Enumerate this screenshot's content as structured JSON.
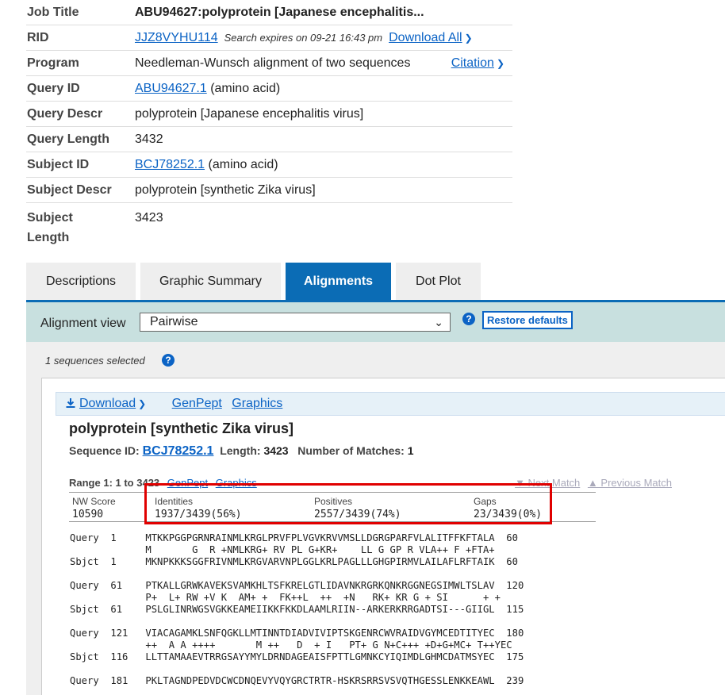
{
  "summary": {
    "job_title": {
      "label": "Job Title",
      "value": "ABU94627:polyprotein [Japanese encephalitis..."
    },
    "rid": {
      "label": "RID",
      "value": "JJZ8VYHU114",
      "expires": "Search expires on 09-21 16:43 pm",
      "download_all": "Download All"
    },
    "program": {
      "label": "Program",
      "value": "Needleman-Wunsch alignment of two sequences",
      "citation": "Citation"
    },
    "query_id": {
      "label": "Query ID",
      "link": "ABU94627.1",
      "suffix": "(amino acid)"
    },
    "query_descr": {
      "label": "Query Descr",
      "value": "polyprotein [Japanese encephalitis virus]"
    },
    "query_length": {
      "label": "Query Length",
      "value": "3432"
    },
    "subject_id": {
      "label": "Subject ID",
      "link": "BCJ78252.1",
      "suffix": "(amino acid)"
    },
    "subject_descr": {
      "label": "Subject Descr",
      "value": "polyprotein [synthetic Zika virus]"
    },
    "subject_length": {
      "label1": "Subject",
      "label2": "Length",
      "value": "3423"
    }
  },
  "tabs": [
    {
      "label": "Descriptions",
      "active": false
    },
    {
      "label": "Graphic Summary",
      "active": false
    },
    {
      "label": "Alignments",
      "active": true
    },
    {
      "label": "Dot Plot",
      "active": false
    }
  ],
  "viewbar": {
    "label": "Alignment view",
    "selected": "Pairwise",
    "restore": "Restore defaults"
  },
  "results": {
    "selected_count": "1 sequences selected",
    "download": "Download",
    "genpept": "GenPept",
    "graphics": "Graphics",
    "seq_title": "polyprotein [synthetic Zika virus]",
    "seq_id_label": "Sequence ID:",
    "seq_id": "BCJ78252.1",
    "length_label": "Length:",
    "length": "3423",
    "matches_label": "Number of Matches:",
    "matches": "1",
    "range_label": "Range 1: 1 to 3423",
    "range_genpept": "GenPept",
    "range_graphics": "Graphics",
    "next_match": "▼ Next Match",
    "prev_match": "▲ Previous Match",
    "scores": {
      "nw_label": "NW Score",
      "nw": "10590",
      "id_label": "Identities",
      "id": "1937/3439(56%)",
      "pos_label": "Positives",
      "pos": "2557/3439(74%)",
      "gaps_label": "Gaps",
      "gaps": "23/3439(0%)"
    },
    "alignment_text": "Query  1     MTKKPGGPGRNRAINMLKRGLPRVFPLVGVKRVVMSLLDGRGPARFVLALITFFKFTALA  60\n             M       G  R +NMLKRG+ RV PL G+KR+    LL G GP R VLA++ F +FTA+\nSbjct  1     MKNPKKKSGGFRIVNMLKRGVARVNPLGGLKRLPAGLLLGHGPIRMVLAILAFLRFTAIK  60\n\nQuery  61    PTKALLGRWKAVEKSVAMKHLTSFKRELGTLIDAVNKRGRKQNKRGGNEGSIMWLTSLAV  120\n             P+  L+ RW +V K  AM+ +  FK++L  ++  +N   RK+ KR G + SI      + +\nSbjct  61    PSLGLINRWGSVGKKEAMEIIKKFKKDLAAMLRIIN--ARKERKRRGADTSI---GIIGL  115\n\nQuery  121   VIACAGAMKLSNFQGKLLMTINNTDIADVIVIPTSKGENRCWVRAIDVGYMCEDTITYEC  180\n             ++  A A ++++       M ++   D  + I   PT+ G N+C+++ +D+G+MC+ T++YEC\nSbjct  116   LLTTAMAAEVTRRGSAYYMYLDRNDAGEAISFPTTLGMNKCYIQIMDLGHMCDATMSYEC  175\n\nQuery  181   PKLTAGNDPEDVDCWCDNQEVYVQYGRCTRTR-HSKRSRRSVSVQTHGESSLENKKEAWL  239"
  }
}
